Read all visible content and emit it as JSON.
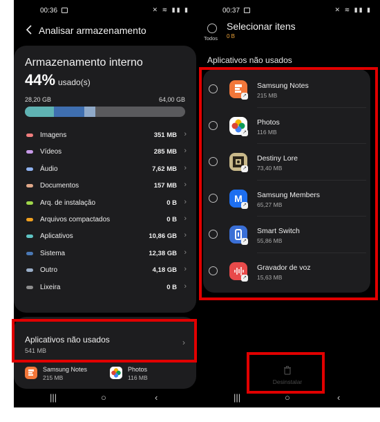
{
  "left": {
    "status": {
      "time": "00:36",
      "icons": "✕ ≋ ▮▮ ▮"
    },
    "title": "Analisar armazenamento",
    "storage": {
      "title": "Armazenamento interno",
      "percent": "44%",
      "percent_label": "usado(s)",
      "used": "28,20 GB",
      "total": "64,00 GB",
      "bar_fractions": [
        {
          "color": "#5fb3b3",
          "fraction": 0.18
        },
        {
          "color": "#3f6fb0",
          "fraction": 0.19
        },
        {
          "color": "#8fa9c8",
          "fraction": 0.07
        }
      ],
      "categories": [
        {
          "name": "Imagens",
          "size": "351 MB",
          "color": "#f07d7d"
        },
        {
          "name": "Vídeos",
          "size": "285 MB",
          "color": "#c89ae8"
        },
        {
          "name": "Áudio",
          "size": "7,62 MB",
          "color": "#8fb2f0"
        },
        {
          "name": "Documentos",
          "size": "157 MB",
          "color": "#e0a889"
        },
        {
          "name": "Arq. de instalação",
          "size": "0 B",
          "color": "#9fd64a"
        },
        {
          "name": "Arquivos compactados",
          "size": "0 B",
          "color": "#f0a020"
        },
        {
          "name": "Aplicativos",
          "size": "10,86 GB",
          "color": "#5fc4c4"
        },
        {
          "name": "Sistema",
          "size": "12,38 GB",
          "color": "#4a78b5"
        },
        {
          "name": "Outro",
          "size": "4,18 GB",
          "color": "#9aaec8"
        },
        {
          "name": "Lixeira",
          "size": "0 B",
          "color": "#8d8d8d"
        }
      ]
    },
    "unused": {
      "title": "Aplicativos não usados",
      "size": "541 MB",
      "apps": [
        {
          "name": "Samsung Notes",
          "size": "215 MB",
          "icon": "samsung-notes-icon"
        },
        {
          "name": "Photos",
          "size": "116 MB",
          "icon": "google-photos-icon"
        }
      ]
    }
  },
  "right": {
    "status": {
      "time": "00:37",
      "icons": "✕ ≋ ▮▮ ▮"
    },
    "select_all_label": "Todos",
    "title": "Selecionar itens",
    "selected_size": "0 B",
    "section": "Aplicativos não usados",
    "apps": [
      {
        "name": "Samsung Notes",
        "size": "215 MB",
        "icon": "samsung-notes-icon",
        "color": "#f2773a"
      },
      {
        "name": "Photos",
        "size": "116 MB",
        "icon": "google-photos-icon",
        "color": "#ffffff"
      },
      {
        "name": "Destiny Lore",
        "size": "73,40 MB",
        "icon": "destiny-lore-icon",
        "color": "#c9b98a"
      },
      {
        "name": "Samsung Members",
        "size": "65,27 MB",
        "icon": "samsung-members-icon",
        "color": "#1e6ff0"
      },
      {
        "name": "Smart Switch",
        "size": "55,86 MB",
        "icon": "smart-switch-icon",
        "color": "#3a6fd6"
      },
      {
        "name": "Gravador de voz",
        "size": "15,63 MB",
        "icon": "voice-recorder-icon",
        "color": "#e84a4a"
      }
    ],
    "uninstall_label": "Desinstalar"
  },
  "nav": {
    "recent": "|||",
    "home": "○",
    "back": "‹"
  },
  "highlight_color": "#e10000"
}
